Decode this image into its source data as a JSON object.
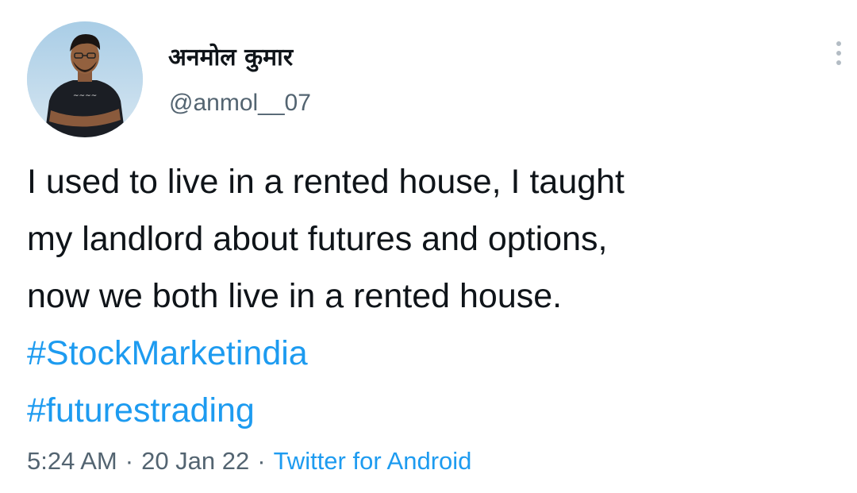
{
  "author": {
    "display_name": "अनमोल कुमार",
    "handle": "@anmol__07",
    "avatar_icon": "user-avatar-photo"
  },
  "tweet": {
    "lines": [
      "I used to live in a rented house, I taught",
      "my landlord about futures and options,",
      "now we both live in a rented house."
    ],
    "hashtags": [
      "#StockMarketindia",
      "#futurestrading"
    ],
    "time": "5:24 AM",
    "date": "20 Jan 22",
    "separator": "·",
    "source": "Twitter for Android"
  },
  "menu": {
    "icon": "more-options-icon"
  },
  "colors": {
    "link": "#1d9bf0",
    "secondary_text": "#536471",
    "primary_text": "#0f1419"
  }
}
